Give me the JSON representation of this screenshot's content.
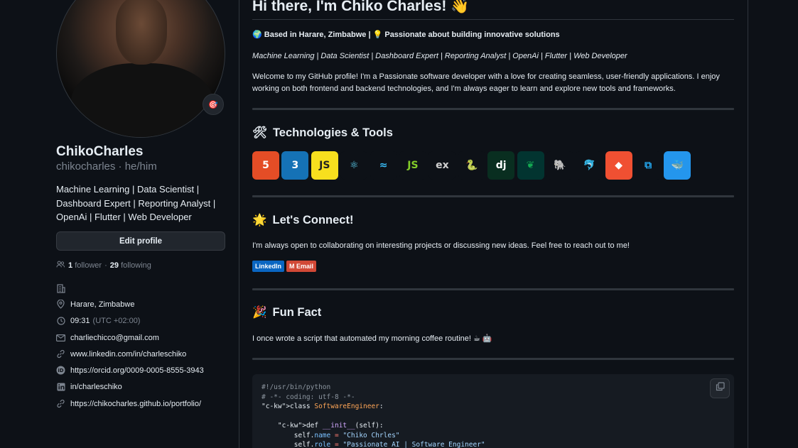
{
  "profile": {
    "display_name": "ChikoCharles",
    "login_line": "chikocharles · he/him",
    "bio": "Machine Learning | Data Scientist | Dashboard Expert | Reporting Analyst | OpenAi | Flutter | Web Developer",
    "edit_button": "Edit profile",
    "followers_count": "1",
    "followers_label": "follower",
    "following_count": "29",
    "following_label": "following",
    "details": {
      "location": "Harare, Zimbabwe",
      "local_time": "09:31",
      "timezone": "(UTC +02:00)",
      "email": "charliechicco@gmail.com",
      "website": "www.linkedin.com/in/charleschiko",
      "orcid": "https://orcid.org/0009-0005-8555-3943",
      "linkedin": "in/charleschiko",
      "portfolio": "https://chikocharles.github.io/portfolio/"
    },
    "status_emoji": "🎯"
  },
  "readme": {
    "heading": "Hi there, I'm Chiko Charles! 👋",
    "based_in": "🌍 Based in Harare, Zimbabwe | 💡 Passionate about building innovative solutions",
    "roles": "Machine Learning | Data Scientist | Dashboard Expert | Reporting Analyst | OpenAi | Flutter | Web Developer",
    "welcome": "Welcome to my GitHub profile! I'm a Passionate software developer with a love for creating seamless, user-friendly applications. I enjoy working on both frontend and backend technologies, and I'm always eager to learn and explore new tools and frameworks.",
    "tech_heading": "Technologies & Tools",
    "tech_emoji": "🛠",
    "tools": [
      {
        "name": "html5",
        "glyph": "5",
        "bg": "#e44d26",
        "fg": "#ffffff"
      },
      {
        "name": "css3",
        "glyph": "3",
        "bg": "#1572b6",
        "fg": "#ffffff"
      },
      {
        "name": "javascript",
        "glyph": "JS",
        "bg": "#f7df1e",
        "fg": "#222222"
      },
      {
        "name": "react",
        "glyph": "⚛",
        "bg": "#0d1117",
        "fg": "#61dafb"
      },
      {
        "name": "tailwind",
        "glyph": "≈",
        "bg": "#0d1117",
        "fg": "#38bdf8"
      },
      {
        "name": "nodejs",
        "glyph": "JS",
        "bg": "#0d1117",
        "fg": "#83cd29"
      },
      {
        "name": "express",
        "glyph": "ex",
        "bg": "#0d1117",
        "fg": "#d0d0d0"
      },
      {
        "name": "python",
        "glyph": "🐍",
        "bg": "#0d1117",
        "fg": "#3776ab"
      },
      {
        "name": "django",
        "glyph": "dj",
        "bg": "#092e20",
        "fg": "#ffffff"
      },
      {
        "name": "mongodb",
        "glyph": "❦",
        "bg": "#023430",
        "fg": "#13aa52"
      },
      {
        "name": "postgresql",
        "glyph": "🐘",
        "bg": "#0d1117",
        "fg": "#c5d7ea"
      },
      {
        "name": "mysql",
        "glyph": "🐬",
        "bg": "#0d1117",
        "fg": "#cfcfcf"
      },
      {
        "name": "git",
        "glyph": "◆",
        "bg": "#f05032",
        "fg": "#ffffff"
      },
      {
        "name": "vscode",
        "glyph": "⧉",
        "bg": "#0d1117",
        "fg": "#23a9f2"
      },
      {
        "name": "docker",
        "glyph": "🐳",
        "bg": "#2496ed",
        "fg": "#ffffff"
      }
    ],
    "connect_heading": "Let's Connect!",
    "connect_emoji": "🌟",
    "connect_text": "I'm always open to collaborating on interesting projects or discussing new ideas. Feel free to reach out to me!",
    "badges": [
      {
        "label": "LinkedIn",
        "bg": "#0a66c2"
      },
      {
        "label": "M Email",
        "bg": "#d14836"
      }
    ],
    "fun_heading": "Fun Fact",
    "fun_emoji": "🎉",
    "fun_text": "I once wrote a script that automated my morning coffee routine! ☕ 🤖",
    "code_lines": [
      "#!/usr/bin/python",
      "# -*- coding: utf-8 -*-",
      "class SoftwareEngineer:",
      "",
      "    def __init__(self):",
      "        self.name = \"Chiko Chrles\"",
      "        self.role = \"Passionate AI | Software Engineer\""
    ]
  },
  "colors": {
    "background": "#0d1117",
    "text": "#e6edf3",
    "muted": "#7d8590",
    "border": "#30363d"
  }
}
